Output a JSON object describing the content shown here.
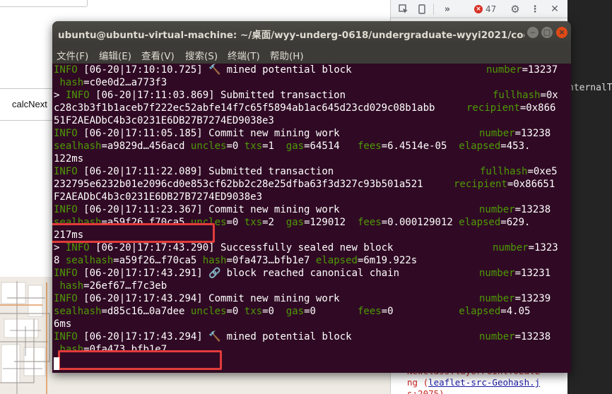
{
  "background": {
    "calc_button_label": "calcNext"
  },
  "devtools": {
    "error_count": "47",
    "side_text": "nternalTy",
    "console_lines": [
      "NewClass.layerPointToLatL",
      "ng ("
    ],
    "console_link": "leaflet-src-Geohash.j",
    "console_tail": "s:2075)"
  },
  "terminal": {
    "title": "ubuntu@ubuntu-virtual-machine: ~/桌面/wyy-underg-0618/undergraduate-wyyi2021/code/t…",
    "menu": [
      "文件(F)",
      "编辑(E)",
      "查看(V)",
      "搜索(S)",
      "终端(T)",
      "帮助(H)"
    ],
    "lines": [
      {
        "lvl": "INFO",
        "ts": "[06-20|17:10:10.725]",
        "icon": "🔨",
        "msg": "mined potential block",
        "kv": "number=13237"
      },
      {
        "text": " hash=c0e0d2…a773f3"
      },
      {
        "prefix": "> ",
        "lvl": "INFO",
        "ts": "[06-20|17:11:03.869]",
        "msg": "Submitted transaction",
        "kv": "fullhash=0x"
      },
      {
        "text": "c28c3b3f1b1aceb7f222ec52abfe14f7c65f5894ab1ac645d23cd029c08b1abb",
        "key": "recipient=0x866"
      },
      {
        "text": "51F2AEADbC4b3c0231E6DB27B7274ED9038e3"
      },
      {
        "lvl": "INFO",
        "ts": "[06-20|17:11:05.185]",
        "msg": "Commit new mining work",
        "kv": "number=13238"
      },
      {
        "text": "sealhash=a9829d…456acd uncles=0 txs=1  gas=64514   fees=6.4514e-05  elapsed=453."
      },
      {
        "text": "122ms"
      },
      {
        "lvl": "INFO",
        "ts": "[06-20|17:11:22.089]",
        "msg": "Submitted transaction",
        "kv": "fullhash=0xe5"
      },
      {
        "text": "232795e6232b01e2096cd0e853cf62bb2c28e25dfba63f3d327c93b501a521",
        "key": "recipient=0x86651"
      },
      {
        "text": "F2AEADbC4b3c0231E6DB27B7274ED9038e3"
      },
      {
        "lvl": "INFO",
        "ts": "[06-20|17:11:23.367]",
        "msg": "Commit new mining work",
        "kv": "number=13238"
      },
      {
        "text": "sealhash=a59f26…f70ca5 uncles=0 txs=2  gas=129012  fees=0.000129012 elapsed=629."
      },
      {
        "text": "217ms"
      },
      {
        "prefix": "> ",
        "lvl": "INFO",
        "ts": "[06-20|17:17:43.290]",
        "msg": "Successfully sealed new block",
        "kv": "number=1323"
      },
      {
        "text": "8 sealhash=a59f26…f70ca5 hash=0fa473…bfb1e7 elapsed=6m19.922s"
      },
      {
        "lvl": "INFO",
        "ts": "[06-20|17:17:43.291]",
        "icon": "🔗",
        "msg": "block reached canonical chain",
        "kv": "number=13231"
      },
      {
        "text": " hash=26ef67…f7c3eb"
      },
      {
        "lvl": "INFO",
        "ts": "[06-20|17:17:43.294]",
        "msg": "Commit new mining work",
        "kv": "number=13239"
      },
      {
        "text": "sealhash=d85c16…0a7dee uncles=0 txs=0  gas=0       fees=0           elapsed=4.05"
      },
      {
        "text": "6ms"
      },
      {
        "lvl": "INFO",
        "ts": "[06-20|17:17:43.294]",
        "icon": "🔨",
        "msg": "mined potential block",
        "kv": "number=13238"
      },
      {
        "text": " hash=0fa473…bfb1e7"
      }
    ]
  },
  "colors": {
    "terminal_bg": "#300a24",
    "log_green": "#4e9a06",
    "highlight_red": "#e23b3b"
  }
}
